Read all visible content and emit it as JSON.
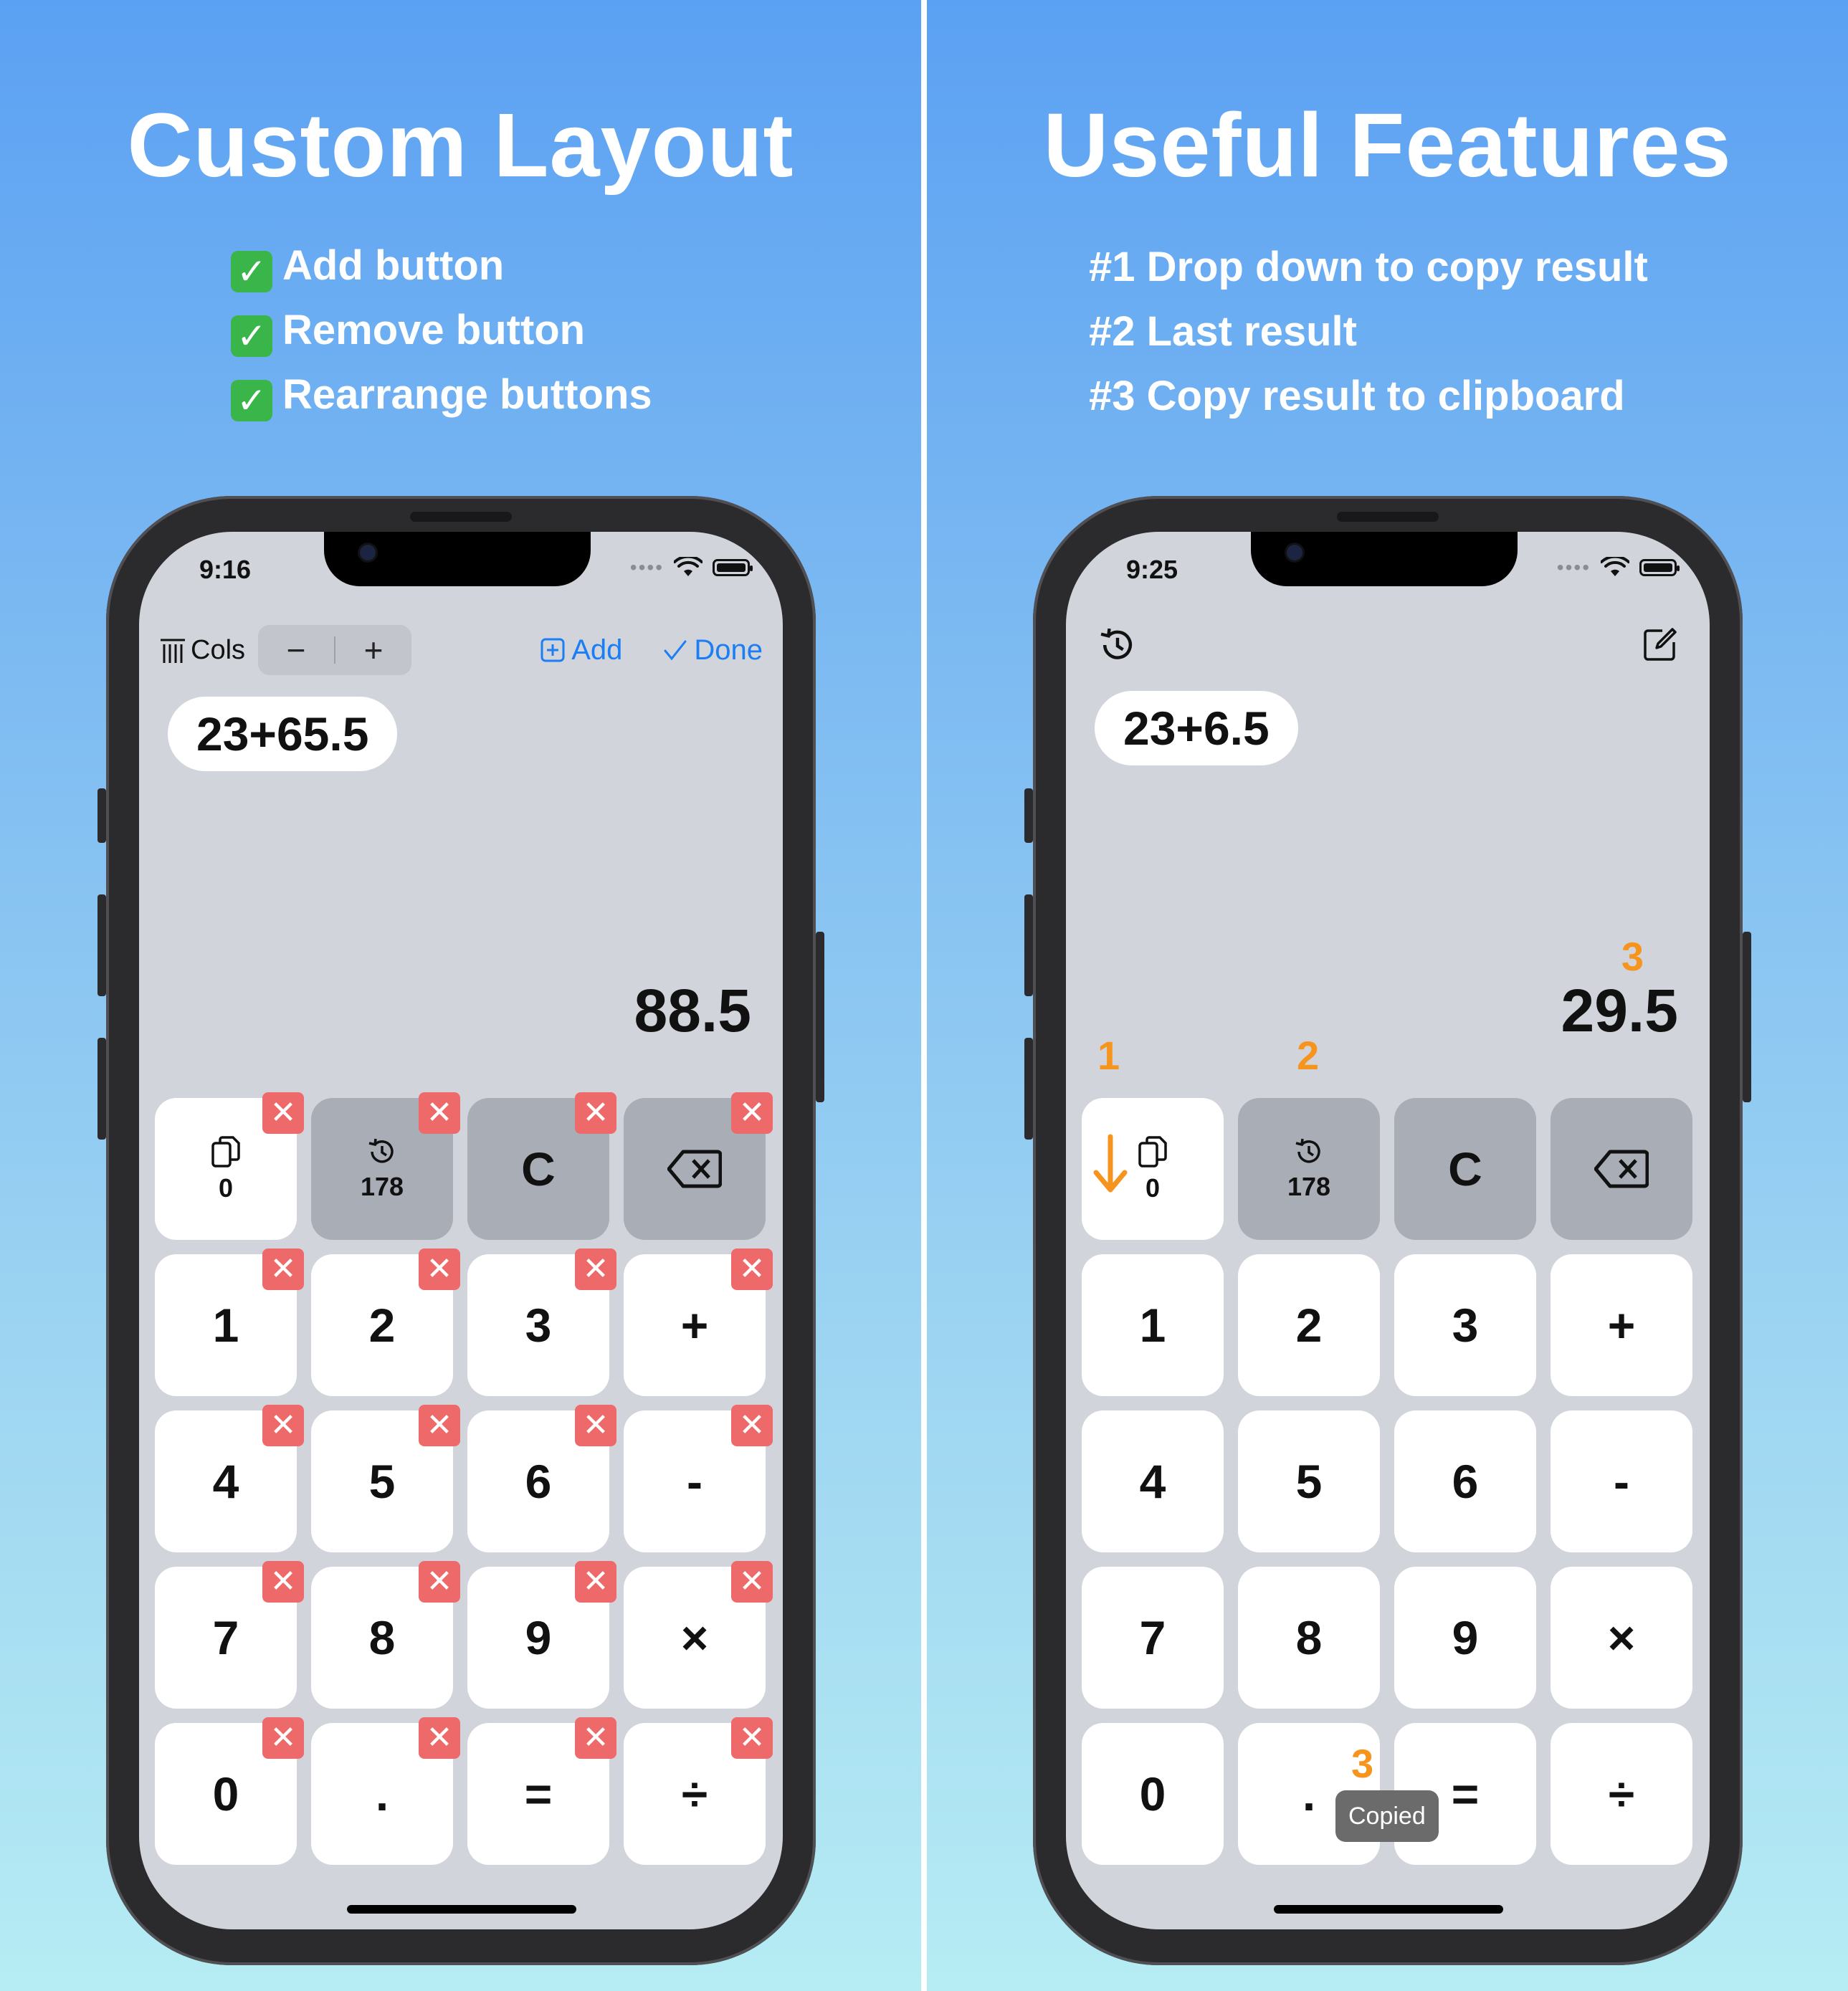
{
  "left": {
    "headline": "Custom Layout",
    "features": [
      "Add button",
      "Remove button",
      "Rearrange buttons"
    ],
    "phone": {
      "time": "9:16",
      "cols_label": "Cols",
      "stepper_minus": "−",
      "stepper_plus": "+",
      "add_label": "Add",
      "done_label": "Done",
      "expression": "23+65.5",
      "result": "88.5",
      "copy_value": "0",
      "last_result": "178",
      "clear": "C",
      "keys": [
        "1",
        "2",
        "3",
        "+",
        "4",
        "5",
        "6",
        "-",
        "7",
        "8",
        "9",
        "×",
        "0",
        ".",
        "=",
        "÷"
      ]
    }
  },
  "right": {
    "headline": "Useful Features",
    "features": [
      "#1 Drop down to copy result",
      "#2 Last result",
      "#3 Copy result to clipboard"
    ],
    "phone": {
      "time": "9:25",
      "expression": "23+6.5",
      "result": "29.5",
      "copy_value": "0",
      "last_result": "178",
      "clear": "C",
      "keys": [
        "1",
        "2",
        "3",
        "+",
        "4",
        "5",
        "6",
        "-",
        "7",
        "8",
        "9",
        "×",
        "0",
        ".",
        "=",
        "÷"
      ],
      "markers": {
        "one": "1",
        "two": "2",
        "three_result": "3",
        "three_copied": "3"
      },
      "copied_toast": "Copied"
    }
  },
  "colors": {
    "accent_blue": "#1b7ef3",
    "delete_red": "#ee6a6a",
    "annotation_orange": "#f7941d"
  }
}
